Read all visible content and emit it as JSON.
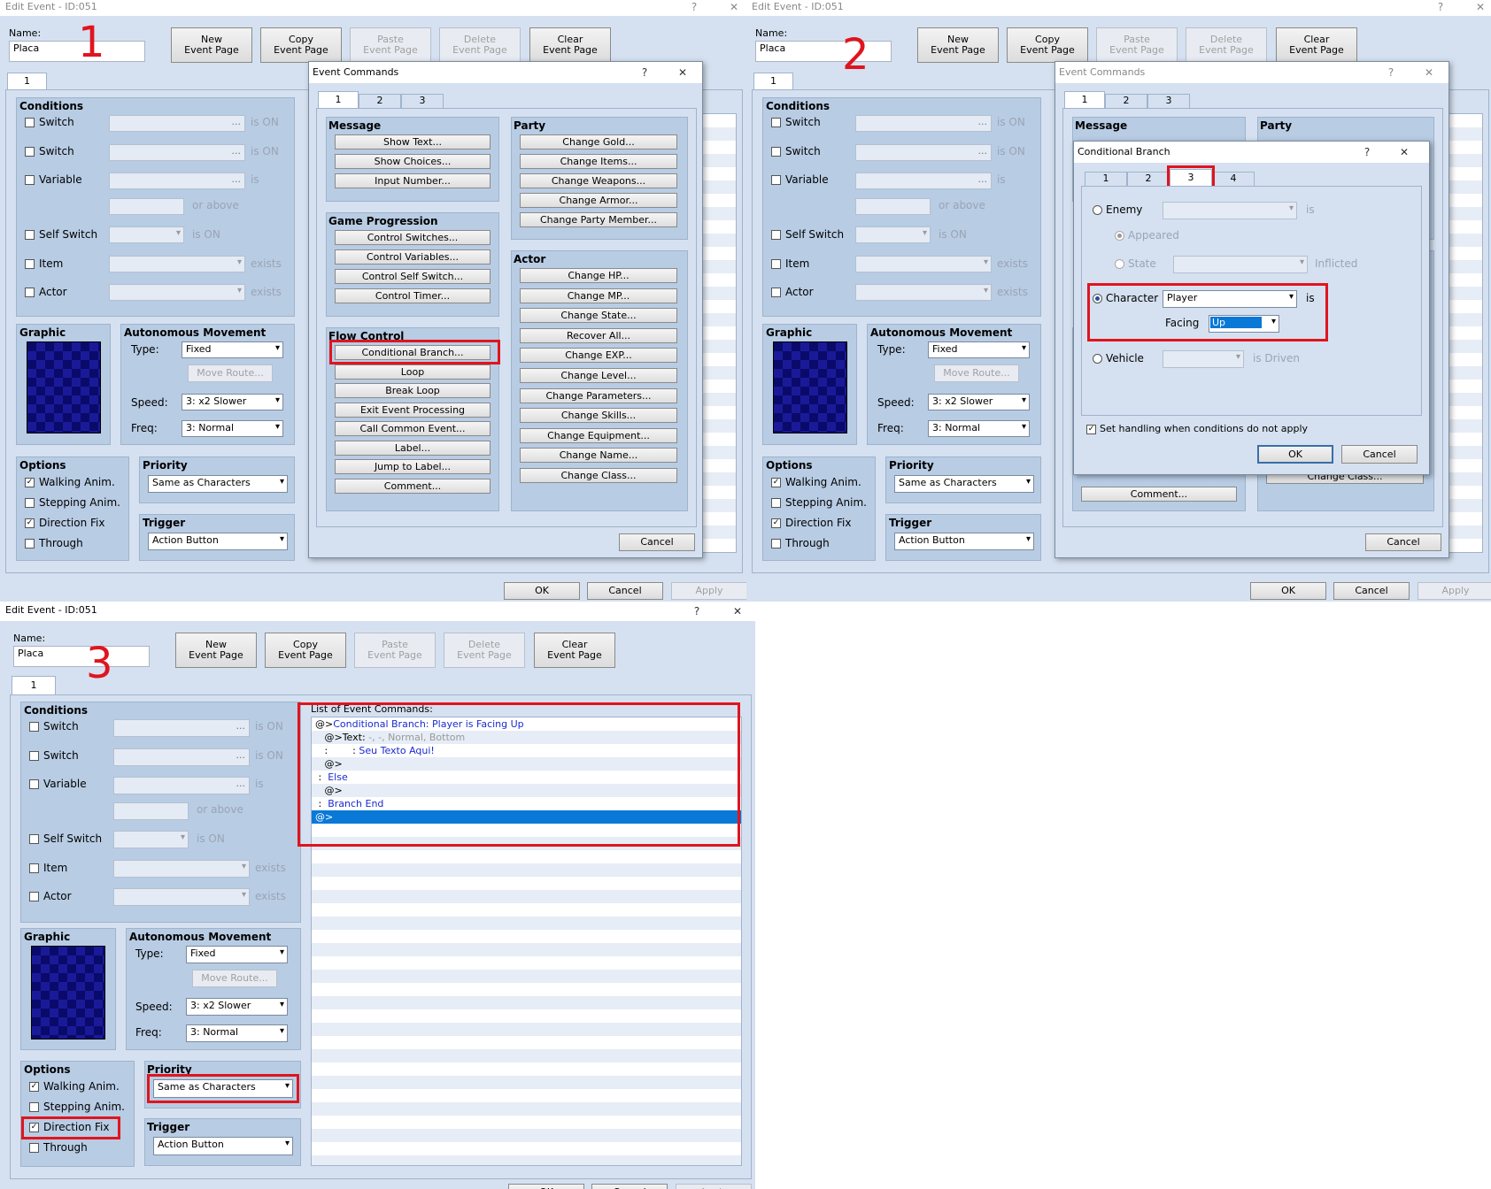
{
  "window_title": "Edit Event - ID:051",
  "step_numbers": [
    "1",
    "2",
    "3"
  ],
  "name_label": "Name:",
  "name_value": "Placa",
  "toolbar": {
    "new": [
      "New",
      "Event Page"
    ],
    "copy": [
      "Copy",
      "Event Page"
    ],
    "paste": [
      "Paste",
      "Event Page"
    ],
    "delete": [
      "Delete",
      "Event Page"
    ],
    "clear": [
      "Clear",
      "Event Page"
    ]
  },
  "page_tab": "1",
  "conditions": {
    "title": "Conditions",
    "switch1": "Switch",
    "switch2": "Switch",
    "variable": "Variable",
    "self_switch": "Self Switch",
    "item": "Item",
    "actor": "Actor",
    "is_on": "is ON",
    "is": "is",
    "or_above": "or above",
    "exists": "exists",
    "dots": "..."
  },
  "graphic_title": "Graphic",
  "movement": {
    "title": "Autonomous Movement",
    "type_label": "Type:",
    "type_value": "Fixed",
    "move_route": "Move Route...",
    "speed_label": "Speed:",
    "speed_value": "3: x2 Slower",
    "freq_label": "Freq:",
    "freq_value": "3: Normal"
  },
  "options": {
    "title": "Options",
    "walking": "Walking Anim.",
    "stepping": "Stepping Anim.",
    "direction_fix": "Direction Fix",
    "through": "Through"
  },
  "priority": {
    "title": "Priority",
    "value": "Same as Characters"
  },
  "trigger": {
    "title": "Trigger",
    "value": "Action Button"
  },
  "bottom": {
    "ok": "OK",
    "cancel": "Cancel",
    "apply": "Apply"
  },
  "event_commands": {
    "title": "Event Commands",
    "tabs": [
      "1",
      "2",
      "3"
    ],
    "message_title": "Message",
    "message": [
      "Show Text...",
      "Show Choices...",
      "Input Number..."
    ],
    "game_title": "Game Progression",
    "game": [
      "Control Switches...",
      "Control Variables...",
      "Control Self Switch...",
      "Control Timer..."
    ],
    "flow_title": "Flow Control",
    "flow": [
      "Conditional Branch...",
      "Loop",
      "Break Loop",
      "Exit Event Processing",
      "Call Common Event...",
      "Label...",
      "Jump to Label...",
      "Comment..."
    ],
    "party_title": "Party",
    "party": [
      "Change Gold...",
      "Change Items...",
      "Change Weapons...",
      "Change Armor...",
      "Change Party Member..."
    ],
    "actor_title": "Actor",
    "actor": [
      "Change HP...",
      "Change MP...",
      "Change State...",
      "Recover All...",
      "Change EXP...",
      "Change Level...",
      "Change Parameters...",
      "Change Skills...",
      "Change Equipment...",
      "Change Name...",
      "Change Class..."
    ],
    "cancel": "Cancel"
  },
  "conditional_branch": {
    "title": "Conditional Branch",
    "tabs": [
      "1",
      "2",
      "3",
      "4"
    ],
    "enemy": "Enemy",
    "is": "is",
    "appeared": "Appeared",
    "state": "State",
    "inflicted": "Inflicted",
    "character": "Character",
    "character_value": "Player",
    "facing": "Facing",
    "facing_value": "Up",
    "vehicle": "Vehicle",
    "is_driven": "is Driven",
    "else_label": "Set handling when conditions do not apply",
    "ok": "OK",
    "cancel": "Cancel"
  },
  "list": {
    "title": "List of Event Commands:",
    "lines": [
      {
        "prefix": "@>",
        "text": "Conditional Branch: Player is Facing Up"
      },
      {
        "prefix": "   @>Text: ",
        "text": "-, -, Normal, Bottom"
      },
      {
        "prefix": "   :        : ",
        "text": "Seu Texto Aqui!"
      },
      {
        "prefix": "   @>",
        "text": ""
      },
      {
        "prefix": " :  ",
        "text": "Else"
      },
      {
        "prefix": "   @>",
        "text": ""
      },
      {
        "prefix": " :  ",
        "text": "Branch End"
      },
      {
        "prefix": "@>",
        "text": ""
      }
    ]
  },
  "title_icons": {
    "help": "?",
    "close": "✕"
  },
  "colors": {
    "highlight": "#e0141e",
    "selection": "#0a78d7",
    "panel": "#b8cce4",
    "window": "#d5e1f0"
  }
}
